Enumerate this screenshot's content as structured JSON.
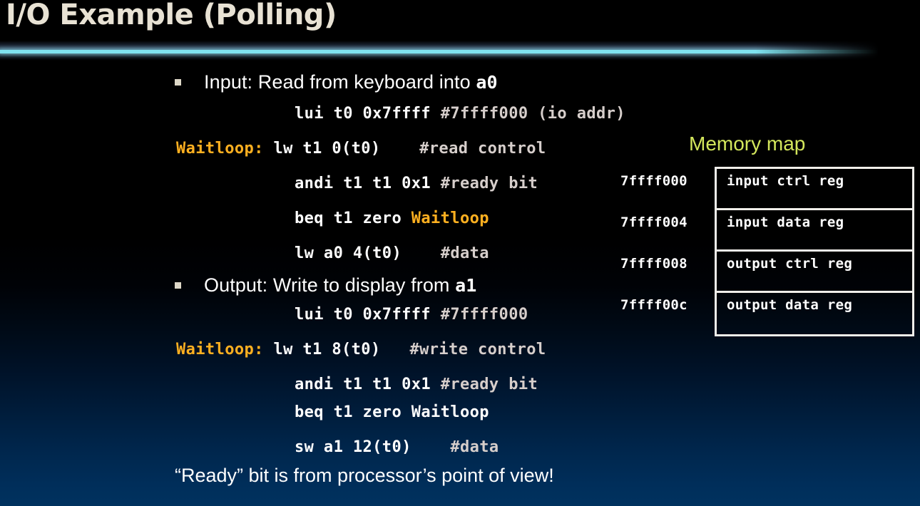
{
  "slide": {
    "title": "I/O Example (Polling)",
    "footnote": "“Ready” bit is from processor’s point of view!"
  },
  "bullets": [
    {
      "text_before": "Input: Read from keyboard into ",
      "mono": "a0",
      "text_after": ""
    },
    {
      "text_before": "Output: Write to display from ",
      "mono": "a1",
      "text_after": ""
    }
  ],
  "code_input": [
    {
      "label": "",
      "code": "lui t0 0x7ffff ",
      "comment": "#7ffff000 (io addr)"
    },
    {
      "label": "Waitloop:",
      "code": " lw t1 0(t0)    ",
      "comment": "#read control"
    },
    {
      "label": "",
      "code": "andi t1 t1 0x1 ",
      "comment": "#ready bit"
    },
    {
      "label": "",
      "code": "beq t1 zero ",
      "target": "Waitloop",
      "comment": ""
    },
    {
      "label": "",
      "code": "lw a0 4(t0)    ",
      "comment": "#data"
    }
  ],
  "code_output": [
    {
      "label": "",
      "code": "lui t0 0x7ffff ",
      "comment": "#7ffff000"
    },
    {
      "label": "Waitloop:",
      "code": " lw t1 8(t0)   ",
      "comment": "#write control"
    },
    {
      "label": "",
      "code": "andi t1 t1 0x1 ",
      "comment": "#ready bit"
    },
    {
      "label": "",
      "code": "beq t1 zero Waitloop",
      "comment": ""
    },
    {
      "label": "",
      "code": "sw a1 12(t0)    ",
      "comment": "#data"
    }
  ],
  "memory_map": {
    "title": "Memory map",
    "rows": [
      {
        "address": "7ffff000",
        "register": "input ctrl reg"
      },
      {
        "address": "7ffff004",
        "register": "input data reg"
      },
      {
        "address": "7ffff008",
        "register": "output ctrl reg"
      },
      {
        "address": "7ffff00c",
        "register": "output data reg"
      }
    ]
  },
  "colors": {
    "title_text": "#e8e2d4",
    "divider_line": "#7fe3f0",
    "label_orange": "#ffb020",
    "comment_gray": "#d6cecb",
    "memmap_title": "#d3e65c",
    "body_text": "#ffffff",
    "bullet_marker": "#ded8c8",
    "background_top": "#000000",
    "background_bottom": "#00325f"
  }
}
